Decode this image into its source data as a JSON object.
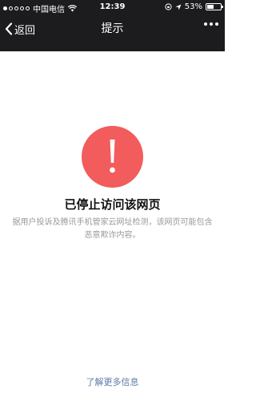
{
  "status_bar": {
    "carrier": "中国电信",
    "time": "12:39",
    "battery_text": "53%",
    "battery_level": 0.53
  },
  "nav": {
    "back_label": "返回",
    "title": "提示"
  },
  "content": {
    "heading": "已停止访问该网页",
    "description": "据用户投诉及腾讯手机管家云网址检测，该网页可能包含恶意欺诈内容。",
    "more_info_link": "了解更多信息"
  },
  "colors": {
    "nav_background": "#1c1c1f",
    "alert_red": "#f25c5c",
    "link_blue": "#5b7aa6",
    "muted_text": "#9a9a9a"
  },
  "icons": {
    "alert": "exclamation-icon",
    "back": "chevron-left-icon",
    "more": "more-dots-icon",
    "wifi": "wifi-icon",
    "location": "location-arrow-icon",
    "orientation": "orientation-lock-icon"
  }
}
